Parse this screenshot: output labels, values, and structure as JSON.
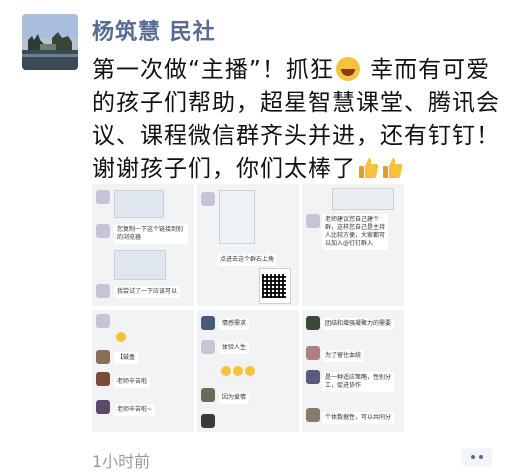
{
  "post": {
    "author": "杨筑慧 民社",
    "text_part1": "第一次做“主播”！抓狂",
    "text_part2": " 幸而有可爱的孩子们帮助，超星智慧课堂、腾讯会议、课程微信群齐头并进，还有钉钉！谢谢孩子们，你们太棒了",
    "emoji_1": "laughing-sweat-emoji",
    "emoji_2": "thumbs-up-emoji",
    "time": "1小时前"
  },
  "images": {
    "cell_1": {
      "msg1": "您复制一下这个链接到别的浏览器",
      "msg2": "我尝试了一下应该可以"
    },
    "cell_2": {
      "msg1": "点进去这个群右上角"
    },
    "cell_3": {
      "msg1": "老师建议您自己建个群，这样您自己是主持人比较方便，大家都可以加入@钉钉群入"
    },
    "cell_4": {
      "msg1": "【鼓盒",
      "msg2": "老师辛苦啦",
      "msg3": "老师辛苦啦~"
    },
    "cell_5": {
      "msg1": "情感需求",
      "msg2": "体验人生",
      "msg3": "因为爱情"
    },
    "cell_6": {
      "msg1": "团结和增强凝聚力的需要",
      "msg2": "为了留住血统",
      "msg3": "是一种适应策略，性别分工，促进协作",
      "msg4": "个体数据性，可以共同分"
    }
  },
  "colors": {
    "author": "#566c94",
    "time": "#9a9a9a",
    "bubble_green": "#a6e35e"
  }
}
